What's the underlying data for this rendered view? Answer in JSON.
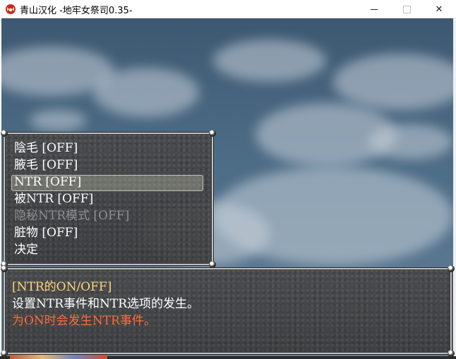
{
  "window": {
    "title": "青山汉化 -地牢女祭司0.35-",
    "icon": "app-icon-red-demon",
    "controls": {
      "minimize": "minimize",
      "maximize": "maximize",
      "close": "✕"
    }
  },
  "menu": {
    "selected_index": 2,
    "items": [
      {
        "label": "陰毛 [OFF]",
        "enabled": true
      },
      {
        "label": "腋毛 [OFF]",
        "enabled": true
      },
      {
        "label": "NTR [OFF]",
        "enabled": true
      },
      {
        "label": "被NTR [OFF]",
        "enabled": true
      },
      {
        "label": "隐秘NTR模式 [OFF]",
        "enabled": false
      },
      {
        "label": "脏物 [OFF]",
        "enabled": true
      },
      {
        "label": "决定",
        "enabled": true
      }
    ]
  },
  "help": {
    "line1": "[NTR的ON/OFF]",
    "line2": "设置NTR事件和NTR选项的发生。",
    "line3": "为ON时会发生NTR事件。"
  },
  "colors": {
    "help_title": "#ffd27a",
    "help_warning": "#ff6a3a",
    "disabled_text": "#8f8f8f"
  }
}
